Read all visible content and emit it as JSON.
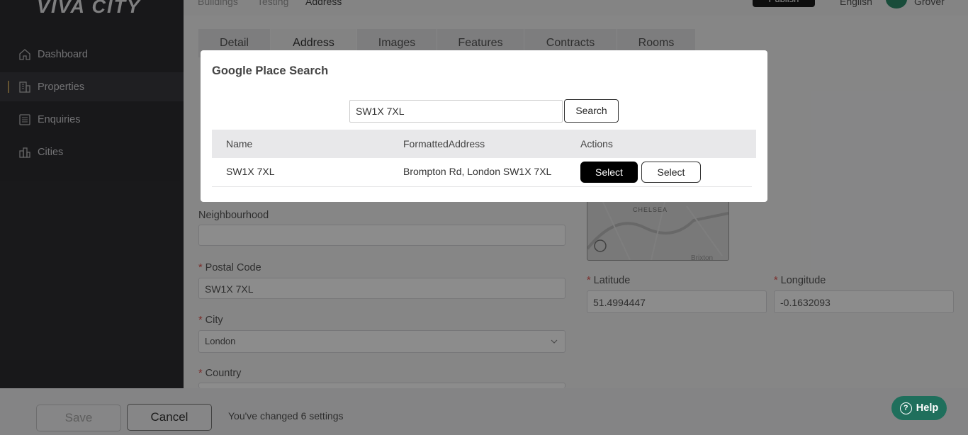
{
  "sidebar": {
    "logo": "VIVA CITY",
    "items": [
      {
        "label": "Dashboard",
        "icon": "home-icon"
      },
      {
        "label": "Properties",
        "icon": "building-icon"
      },
      {
        "label": "Enquiries",
        "icon": "list-icon"
      },
      {
        "label": "Cities",
        "icon": "city-icon"
      }
    ]
  },
  "header": {
    "breadcrumb": [
      "Buildings",
      "Testing",
      "Address"
    ],
    "publish_label": "Publish",
    "language": "English",
    "user_name": "Grover"
  },
  "tabs": [
    "Detail",
    "Address",
    "Images",
    "Features",
    "Contracts",
    "Rooms"
  ],
  "form": {
    "neighbourhood_label": "Neighbourhood",
    "neighbourhood_value": "",
    "postal_code_label": "Postal Code",
    "postal_code_value": "SW1X 7XL",
    "city_label": "City",
    "city_value": "London",
    "country_label": "Country",
    "latitude_label": "Latitude",
    "latitude_value": "51.4994447",
    "longitude_label": "Longitude",
    "longitude_value": "-0.1632093",
    "map_labels": [
      "CHELSEA",
      "Brixton"
    ]
  },
  "footer": {
    "save_label": "Save",
    "cancel_label": "Cancel",
    "changed_text": "You've changed 6 settings",
    "help_label": "Help"
  },
  "modal": {
    "title": "Google Place Search",
    "search_value": "SW1X 7XL",
    "search_button": "Search",
    "columns": [
      "Name",
      "FormattedAddress",
      "Actions"
    ],
    "rows": [
      {
        "name": "SW1X 7XL",
        "address": "Brompton Rd, London SW1X 7XL",
        "action_primary": "Select",
        "action_secondary": "Select"
      }
    ]
  },
  "colors": {
    "sidebar_bg": "#2d2d31",
    "help_bg": "#1f6f5c",
    "avatar_bg": "#2e8b6a",
    "required": "#e0524d"
  }
}
